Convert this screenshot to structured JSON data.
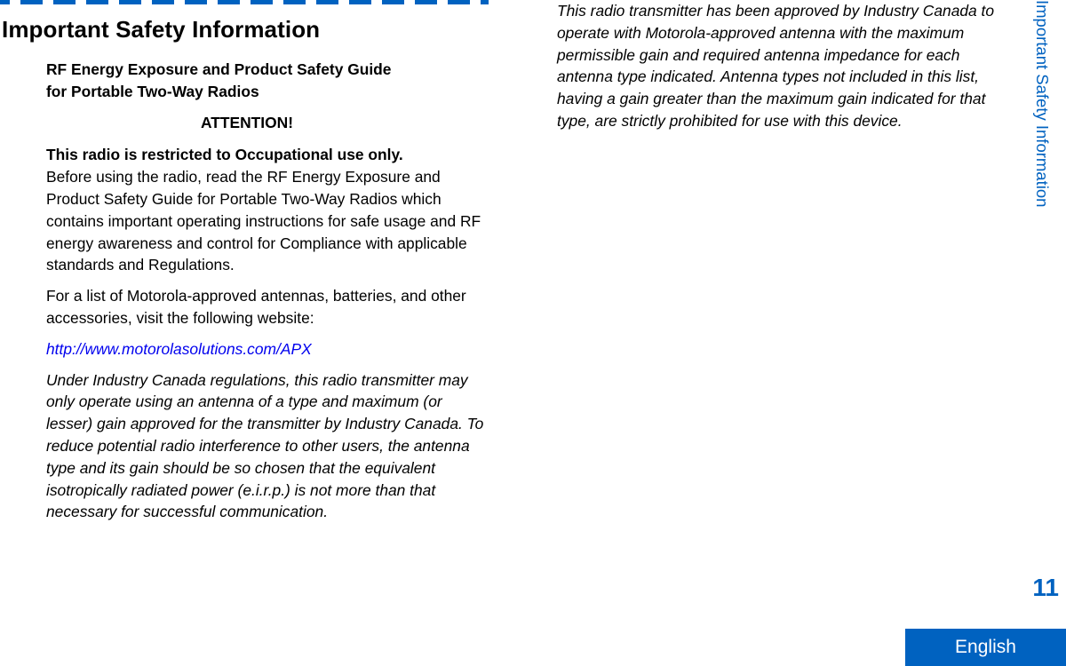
{
  "page": {
    "section_title": "Important Safety Information",
    "running_header": "Important Safety Information",
    "page_number": "11",
    "language_tab": "English",
    "accent_color": "#0062c0",
    "link_color": "#0000ee"
  },
  "left_column": {
    "guide_title_line1": "RF Energy Exposure and Product Safety Guide",
    "guide_title_line2": "for Portable Two-Way Radios",
    "attention": "ATTENTION!",
    "restricted_notice": "This radio is restricted to Occupational use only.",
    "before_using": "Before using the radio, read the RF Energy Exposure and Product Safety Guide for Portable Two-Way Radios which contains important operating instructions for safe usage and RF energy awareness and control for Compliance with applicable standards and Regulations.",
    "accessories_intro": "For a list of Motorola-approved antennas, batteries, and other accessories, visit the following website:",
    "website_link": "http://www.motorolasolutions.com/APX",
    "industry_canada_regulation": "Under Industry Canada regulations, this radio transmitter may only operate using an antenna of a type and maximum (or lesser) gain approved for the transmitter by Industry Canada. To reduce potential radio interference to other users, the antenna type and its gain should be so chosen that the equivalent isotropically radiated power (e.i.r.p.) is not more than that necessary for successful communication."
  },
  "right_column": {
    "industry_canada_approval": "This radio transmitter has been approved by Industry Canada to operate with Motorola-approved antenna with the maximum permissible gain and required antenna impedance for each antenna type indicated. Antenna types not included in this list, having a gain greater than the maximum gain indicated for that type, are strictly prohibited for use with this device."
  }
}
